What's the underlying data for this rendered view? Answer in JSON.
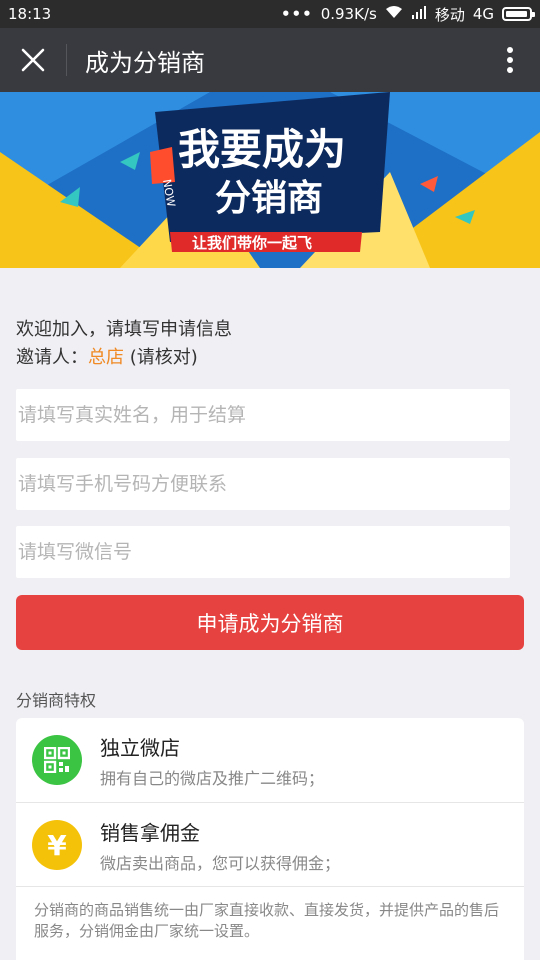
{
  "status_bar": {
    "time": "18:13",
    "dots": "•••",
    "speed": "0.93K/s",
    "carrier": "移动",
    "network": "4G"
  },
  "nav": {
    "title": "成为分销商"
  },
  "banner": {
    "headline_1": "我要成为",
    "headline_2": "分销商",
    "slogan": "让我们带你一起飞",
    "badge": "NOW"
  },
  "welcome": {
    "line1": "欢迎加入，请填写申请信息",
    "inviter_label": "邀请人：",
    "inviter_name": "总店",
    "inviter_note": "(请核对)"
  },
  "form": {
    "name_placeholder": "请填写真实姓名，用于结算",
    "phone_placeholder": "请填写手机号码方便联系",
    "wechat_placeholder": "请填写微信号",
    "submit_label": "申请成为分销商"
  },
  "privileges": {
    "title": "分销商特权",
    "items": [
      {
        "title": "独立微店",
        "desc": "拥有自己的微店及推广二维码；",
        "icon": "qr-code-icon",
        "color": "#3bc443"
      },
      {
        "title": "销售拿佣金",
        "desc": "微店卖出商品，您可以获得佣金；",
        "icon": "yen-icon",
        "color": "#f5c20a"
      }
    ],
    "note": "分销商的商品销售统一由厂家直接收款、直接发货，并提供产品的售后服务，分销佣金由厂家统一设置。"
  },
  "colors": {
    "nav_bg": "#393a3f",
    "accent_red": "#e64340",
    "inviter_orange": "#f08a24",
    "banner_blue": "#1e6fc6",
    "banner_yellow": "#f7c419"
  }
}
